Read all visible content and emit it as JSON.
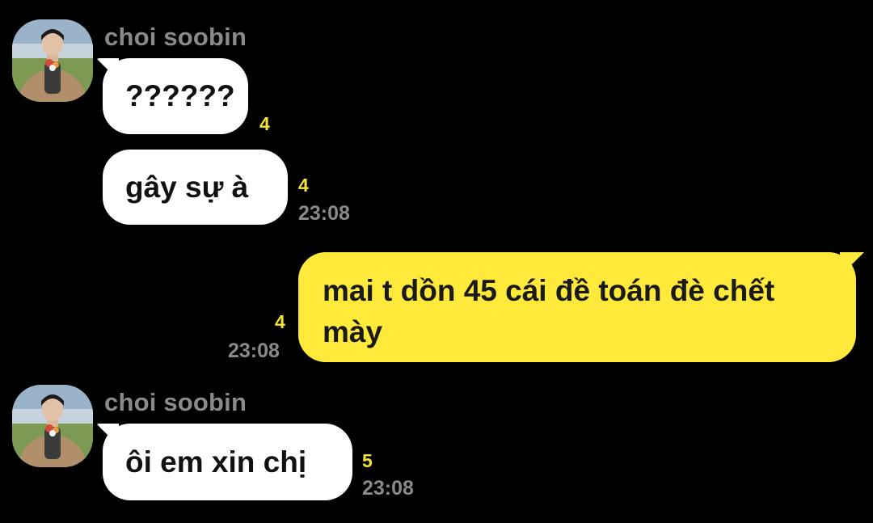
{
  "messages": [
    {
      "sender": "choi soobin",
      "text": "??????",
      "unread": "4",
      "time": "",
      "mine": false
    },
    {
      "sender": "",
      "text": "gây sự à",
      "unread": "4",
      "time": "23:08",
      "mine": false
    },
    {
      "sender": "",
      "text": "mai t dồn 45 cái đề toán đè chết mày",
      "unread": "4",
      "time": "23:08",
      "mine": true
    },
    {
      "sender": "choi soobin",
      "text": "ôi em xin chị",
      "unread": "5",
      "time": "23:08",
      "mine": false
    }
  ],
  "colors": {
    "background": "#000000",
    "incoming_bubble": "#ffffff",
    "outgoing_bubble": "#ffe93b",
    "unread_count": "#f4e23a",
    "meta_text": "#8a8a8a"
  },
  "icons": {
    "avatar": "profile-photo"
  }
}
